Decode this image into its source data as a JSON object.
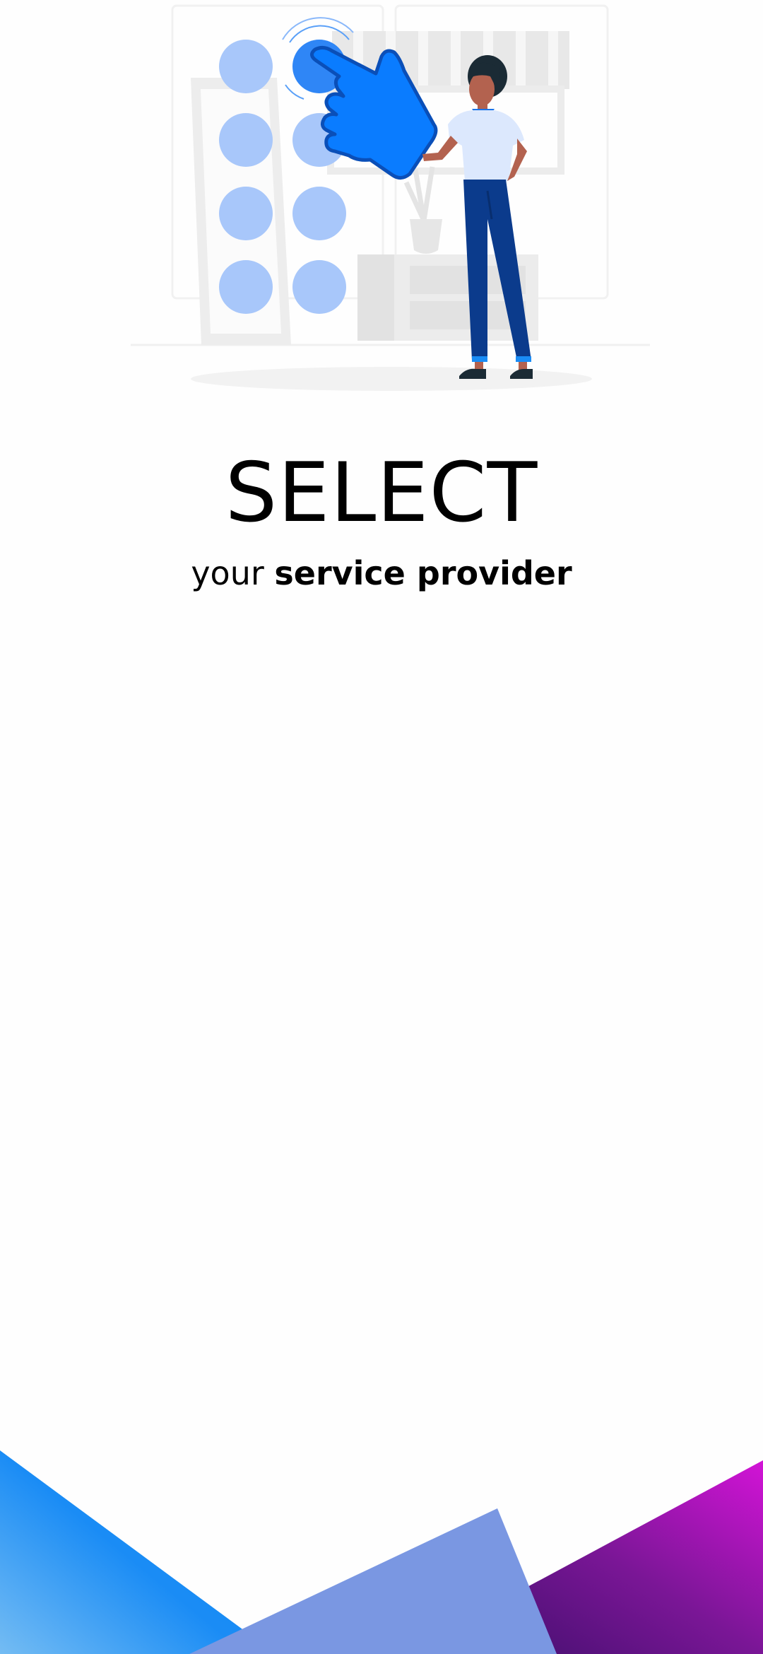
{
  "screen": {
    "name": "service-provider-select",
    "colors": {
      "background": "#fefefe",
      "accent_blue": "#0a7cff",
      "light_blue_dot": "#a8c7fa",
      "trouser_navy": "#0b3b8c",
      "decor_left": "#1a8cf5",
      "decor_middle": "#7a97e2",
      "decor_right": "#b012c8"
    }
  },
  "illustration": {
    "icons": [
      "keypad-illustration",
      "pointing-hand-icon",
      "person-figure"
    ]
  },
  "heading": {
    "title": "SELECT",
    "subtitle_light": "your",
    "subtitle_bold": "service provider"
  }
}
